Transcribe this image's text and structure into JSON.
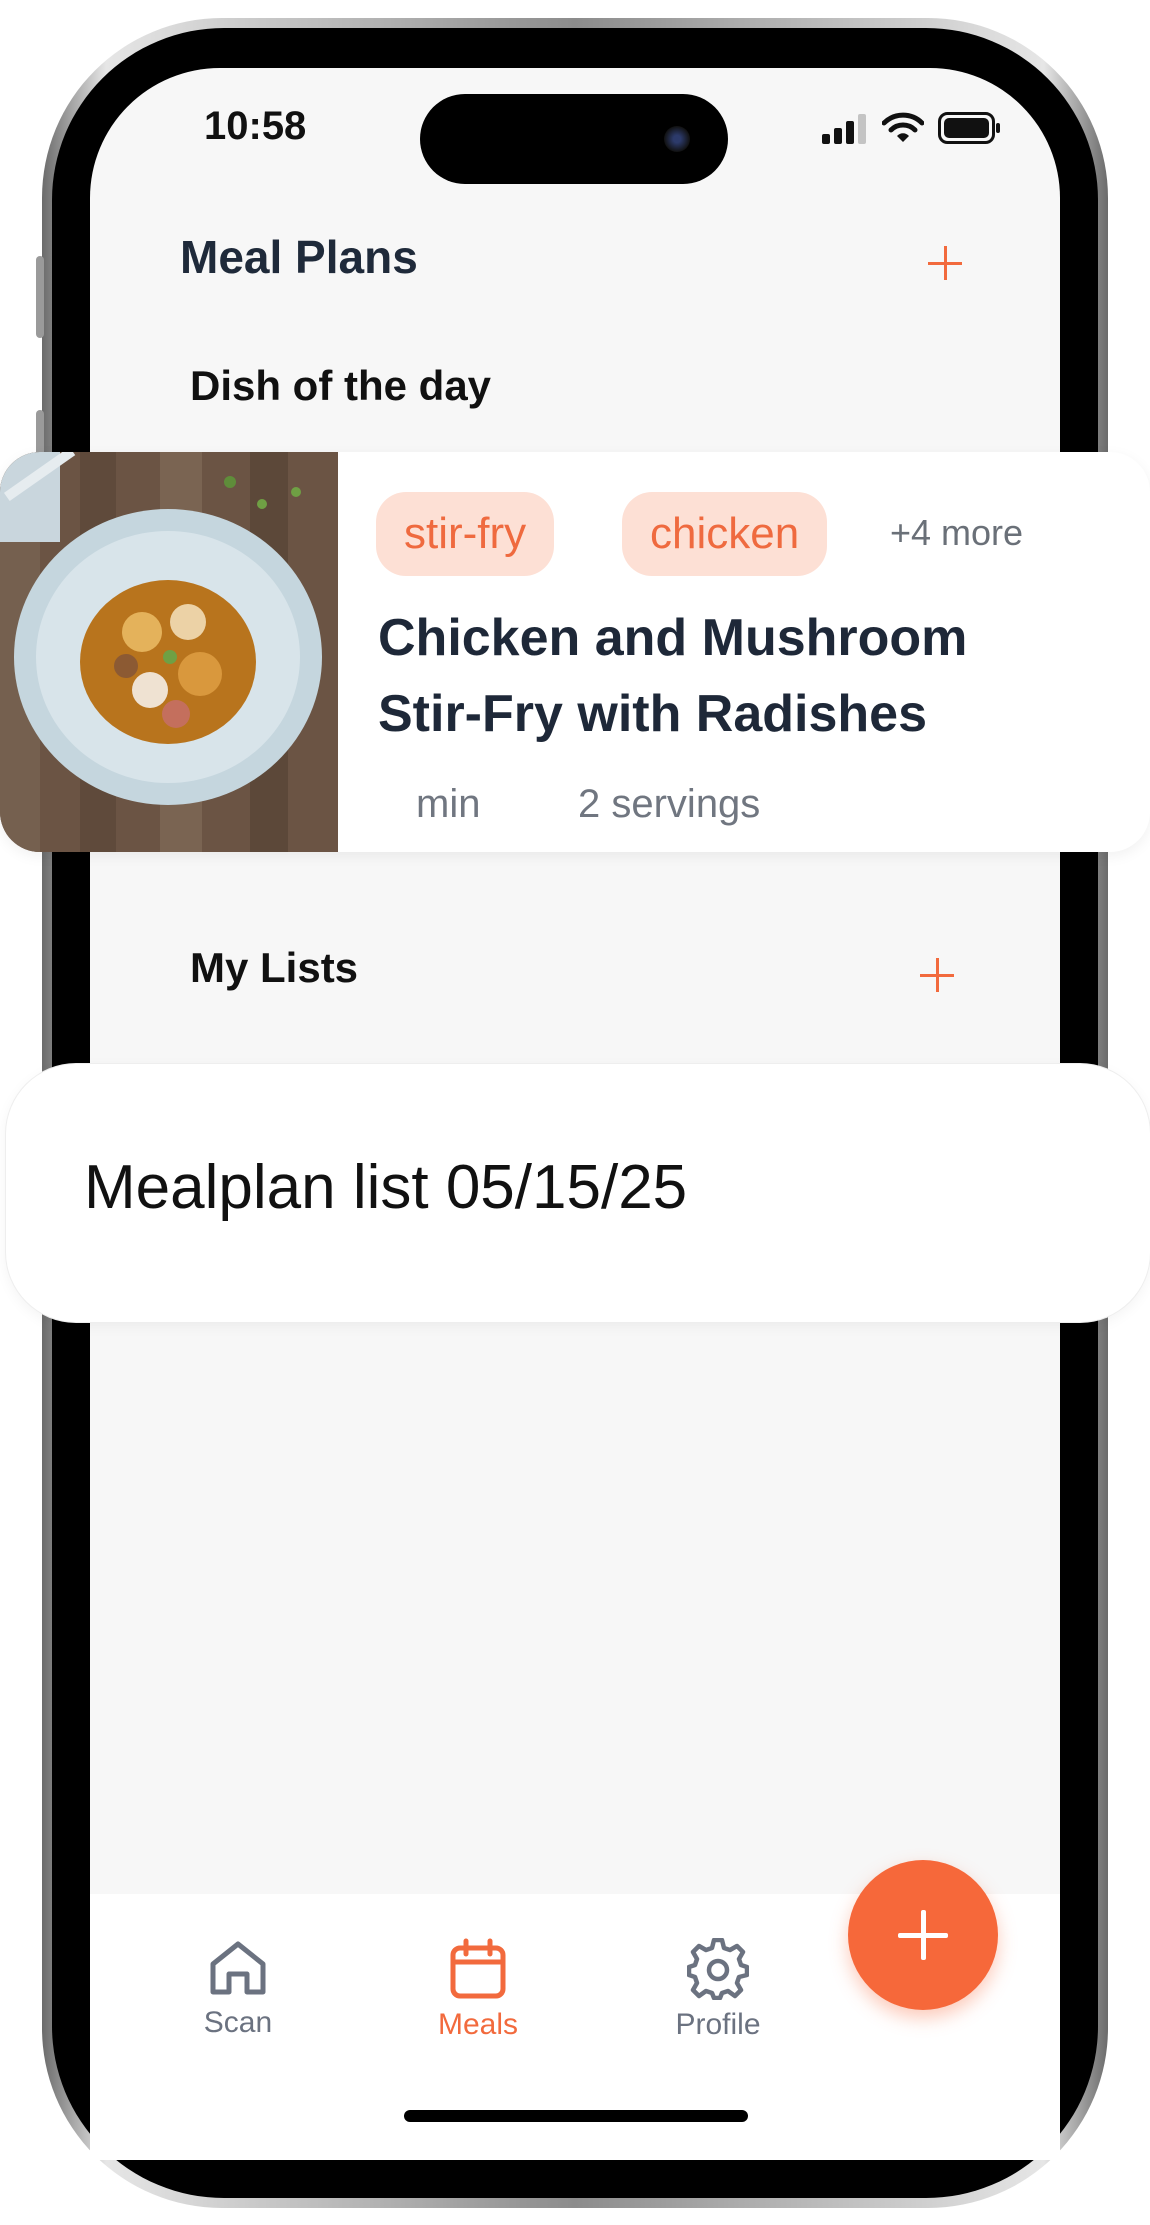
{
  "status_bar": {
    "time": "10:58"
  },
  "header": {
    "title": "Meal Plans"
  },
  "dish_of_the_day": {
    "section_title": "Dish of the day",
    "tags": [
      "stir-fry",
      "chicken"
    ],
    "more_tags": "+4 more",
    "title_line1": "Chicken and Mushroom",
    "title_line2": "Stir-Fry with Radishes",
    "time": "min",
    "servings": "2 servings"
  },
  "my_lists": {
    "section_title": "My Lists",
    "items": [
      {
        "label": "Mealplan list 05/15/25"
      }
    ]
  },
  "bottom_nav": {
    "items": [
      {
        "label": "Scan",
        "icon": "home-icon",
        "active": false
      },
      {
        "label": "Meals",
        "icon": "calendar-icon",
        "active": true
      },
      {
        "label": "Profile",
        "icon": "gear-icon",
        "active": false
      }
    ]
  },
  "colors": {
    "accent": "#f26a3d",
    "tag_bg": "#fde0d5",
    "inactive": "#6b7280"
  }
}
